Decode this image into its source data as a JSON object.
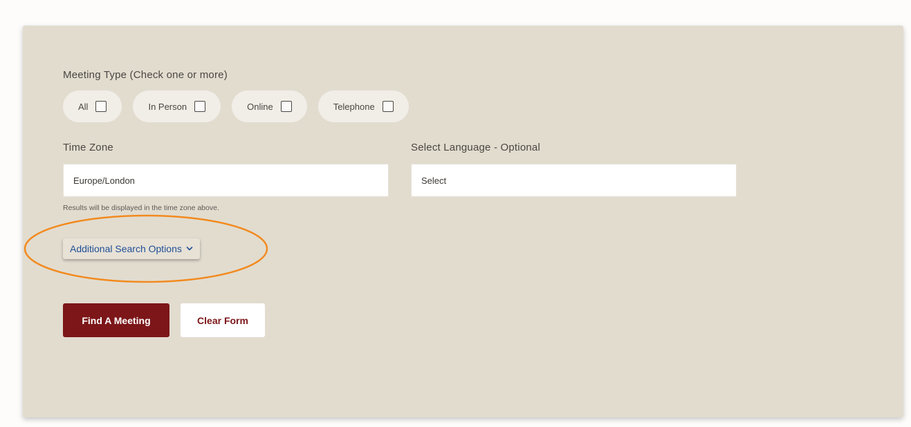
{
  "meeting_type": {
    "label": "Meeting Type (Check one or more)",
    "options": [
      {
        "label": "All"
      },
      {
        "label": "In Person"
      },
      {
        "label": "Online"
      },
      {
        "label": "Telephone"
      }
    ]
  },
  "time_zone": {
    "label": "Time Zone",
    "value": "Europe/London",
    "help": "Results will be displayed in the time zone above."
  },
  "language": {
    "label": "Select Language - Optional",
    "value": "Select"
  },
  "additional_options": {
    "label": "Additional Search Options",
    "icon": "chevron-down-icon"
  },
  "actions": {
    "find_label": "Find A Meeting",
    "clear_label": "Clear Form"
  },
  "colors": {
    "panel_bg": "#e2dccf",
    "primary": "#7c1619",
    "link": "#1f4f96",
    "highlight": "#f28a1e"
  }
}
